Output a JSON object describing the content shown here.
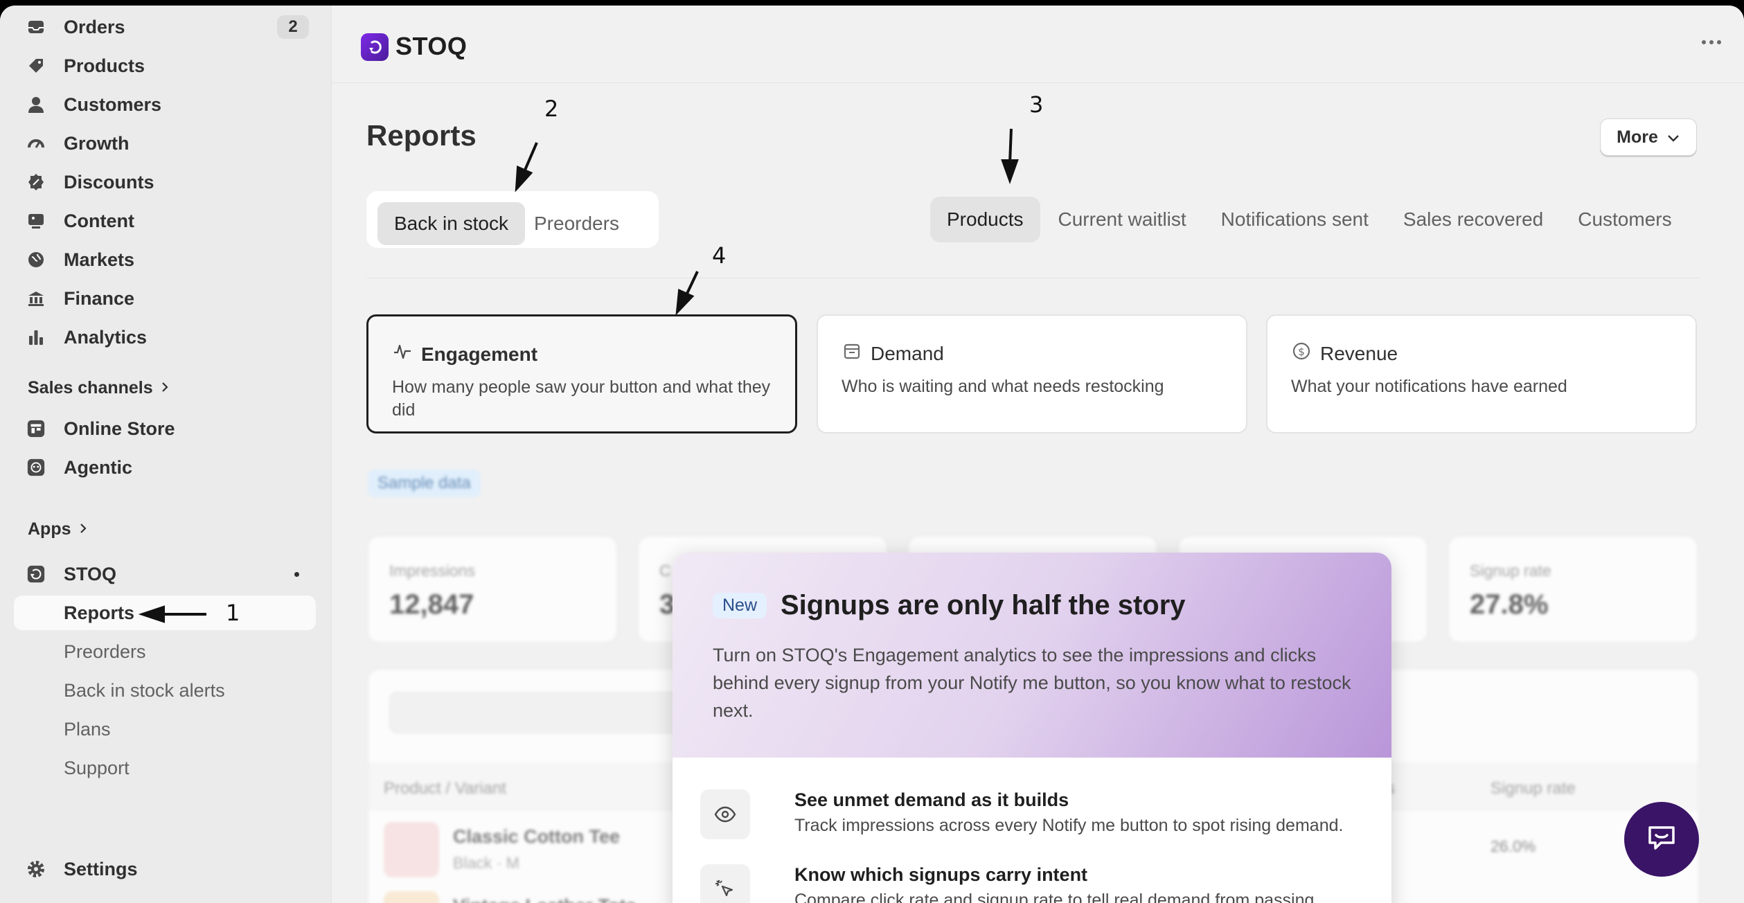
{
  "sidebar": {
    "items": [
      {
        "label": "Orders",
        "badge": "2",
        "icon": "inbox-icon"
      },
      {
        "label": "Products",
        "icon": "tag-icon"
      },
      {
        "label": "Customers",
        "icon": "person-icon"
      },
      {
        "label": "Growth",
        "icon": "gauge-icon"
      },
      {
        "label": "Discounts",
        "icon": "discount-icon"
      },
      {
        "label": "Content",
        "icon": "image-icon"
      },
      {
        "label": "Markets",
        "icon": "globe-icon"
      },
      {
        "label": "Finance",
        "icon": "bank-icon"
      },
      {
        "label": "Analytics",
        "icon": "bar-chart-icon"
      }
    ],
    "sales_channels_label": "Sales channels",
    "channels": [
      {
        "label": "Online Store",
        "icon": "store-icon"
      },
      {
        "label": "Agentic",
        "icon": "robot-icon"
      }
    ],
    "apps_label": "Apps",
    "app": {
      "label": "STOQ"
    },
    "app_sub": [
      "Reports",
      "Preorders",
      "Back in stock alerts",
      "Plans",
      "Support"
    ],
    "settings_label": "Settings"
  },
  "topbar": {
    "brand": "STOQ"
  },
  "page": {
    "title": "Reports",
    "more_label": "More",
    "seg_tabs": [
      "Back in stock",
      "Preorders"
    ],
    "report_tabs": [
      "Products",
      "Current waitlist",
      "Notifications sent",
      "Sales recovered",
      "Customers"
    ],
    "cards": [
      {
        "title": "Engagement",
        "desc": "How many people saw your button and what they did"
      },
      {
        "title": "Demand",
        "desc": "Who is waiting and what needs restocking"
      },
      {
        "title": "Revenue",
        "desc": "What your notifications have earned"
      }
    ],
    "sample_label": "Sample data",
    "metrics": [
      {
        "label": "Impressions",
        "value": "12,847"
      },
      {
        "label": "C",
        "value": "3"
      },
      {
        "label": "",
        "value": ""
      },
      {
        "label": "",
        "value": ""
      },
      {
        "label": "Signup rate",
        "value": "27.8%"
      }
    ],
    "table": {
      "headers": [
        "Product / Variant",
        "s",
        "Signup rate"
      ],
      "rows": [
        {
          "name": "Classic Cotton Tee",
          "variant": "Black · M",
          "rate": "26.0%"
        },
        {
          "name": "Vintage Leather Tote",
          "variant": "",
          "rate": ""
        }
      ]
    }
  },
  "popup": {
    "badge": "New",
    "title": "Signups are only half the story",
    "body": "Turn on STOQ's Engagement analytics to see the impressions and clicks behind every signup from your Notify me button, so you know what to restock next.",
    "features": [
      {
        "title": "See unmet demand as it builds",
        "desc": "Track impressions across every Notify me button to spot rising demand.",
        "icon": "eye-icon"
      },
      {
        "title": "Know which signups carry intent",
        "desc": "Compare click rate and signup rate to tell real demand from passing",
        "icon": "cursor-click-icon"
      }
    ]
  },
  "annotations": [
    "1",
    "2",
    "3",
    "4"
  ]
}
